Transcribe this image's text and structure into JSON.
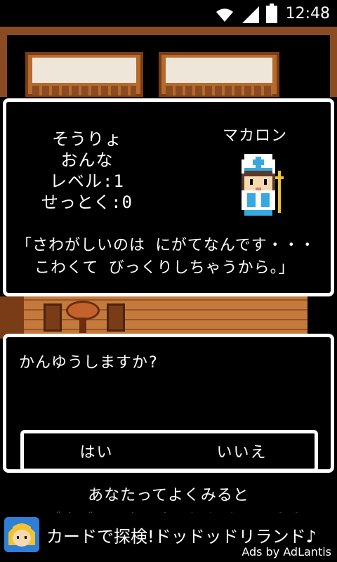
{
  "status_bar": {
    "clock": "12:48",
    "icons": [
      "wifi-icon",
      "signal-icon",
      "battery-icon"
    ]
  },
  "character": {
    "class": "そうりょ",
    "gender": "おんな",
    "level": "レベル:1",
    "virtue": "せっとく:0",
    "name": "マカロン",
    "quote_line1": "「さわがしいのは にがてなんです・・・",
    "quote_line2": "こわくて びっくりしちゃうから。」"
  },
  "prompt": {
    "question": "かんゆうしますか?",
    "yes_label": "はい",
    "no_label": "いいえ"
  },
  "message": {
    "line1": "あなたってよくみると",
    "line2": "ドブネズミみたいな カオ してるわね"
  },
  "ad": {
    "title": "カードで探検!ドッドッドリランド♪",
    "provider": "Ads by AdLantis"
  },
  "colors": {
    "wood": "#8a4b23",
    "wood_light": "#c47a3c",
    "dialog_border": "#ffffff",
    "dialog_bg": "#000000"
  }
}
